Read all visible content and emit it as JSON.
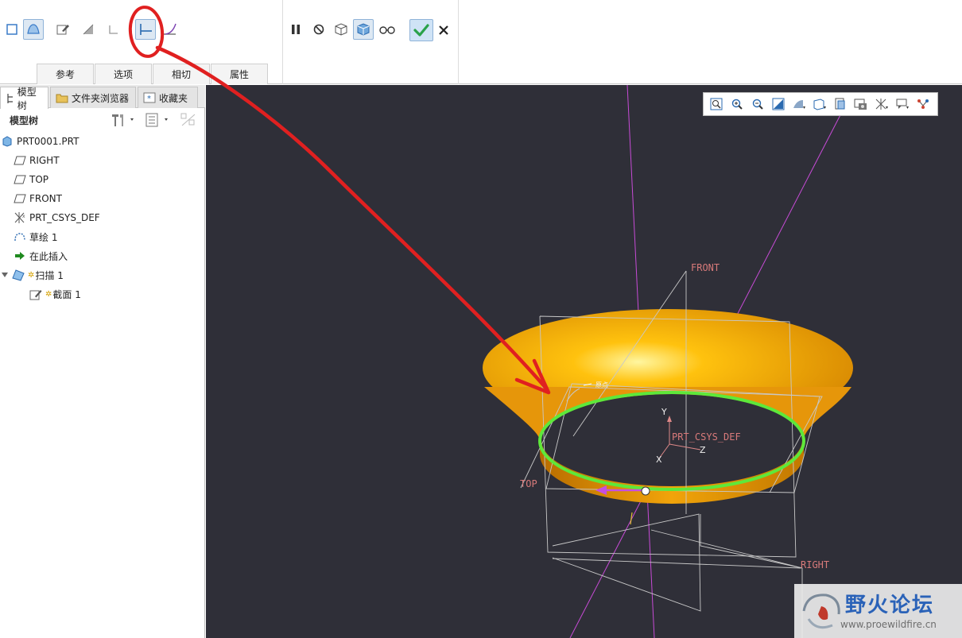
{
  "ribbon": {
    "tabs": [
      {
        "label": "参考"
      },
      {
        "label": "选项"
      },
      {
        "label": "相切"
      },
      {
        "label": "属性"
      }
    ]
  },
  "panel": {
    "tabs": [
      {
        "label": "模型树"
      },
      {
        "label": "文件夹浏览器"
      },
      {
        "label": "收藏夹"
      }
    ],
    "tree_title": "模型树",
    "tree_items": [
      {
        "label": "PRT0001.PRT",
        "icon": "part-icon"
      },
      {
        "label": "RIGHT",
        "icon": "datum-plane-icon"
      },
      {
        "label": "TOP",
        "icon": "datum-plane-icon"
      },
      {
        "label": "FRONT",
        "icon": "datum-plane-icon"
      },
      {
        "label": "PRT_CSYS_DEF",
        "icon": "csys-icon"
      },
      {
        "label": "草绘 1",
        "icon": "sketch-icon"
      },
      {
        "label": "在此插入",
        "icon": "insert-arrow-icon"
      },
      {
        "label": "扫描 1",
        "icon": "sweep-icon"
      },
      {
        "label": "截面 1",
        "icon": "section-icon"
      }
    ]
  },
  "viewport": {
    "labels": {
      "front": "FRONT",
      "top": "TOP",
      "right": "RIGHT",
      "csys": "PRT_CSYS_DEF",
      "axis_x": "X",
      "axis_y": "Y",
      "axis_z": "Z",
      "origin": "原点"
    },
    "colors": {
      "background": "#2f2f38",
      "surface": "#f0a30a",
      "trajectory": "#5ee83a",
      "datum": "#c8c8c8",
      "annotation": "#e02020"
    }
  },
  "watermark": {
    "title": "野火论坛",
    "url": "www.proewildfire.cn"
  }
}
